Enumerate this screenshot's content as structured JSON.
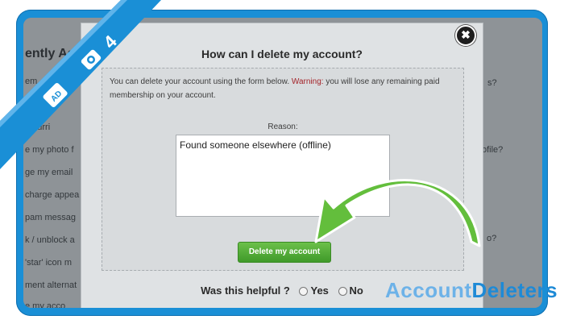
{
  "background_page": {
    "title": "ently As",
    "left_lines": [
      "em",
      "recurri",
      "e my photo f",
      "ge my email",
      "charge appea",
      "pam messag",
      "k / unblock a",
      "'star' icon m",
      "ment alternat",
      "e my acco"
    ],
    "right_lines": [
      "s?",
      "ofile?",
      "o?"
    ]
  },
  "modal": {
    "title": "How can I delete my account?",
    "close_symbol": "✖",
    "info_prefix": "You can delete your account using the form below. ",
    "info_warning": "Warning:",
    "info_suffix": " you will lose any remaining paid membership on your account.",
    "reason_label": "Reason:",
    "reason_value": "Found someone elsewhere (offline)",
    "delete_button": "Delete my account",
    "helpful_question": "Was this helpful ?",
    "helpful_yes": "Yes",
    "helpful_no": "No"
  },
  "banner": {
    "step_number": "4"
  },
  "brand": {
    "part1": "Account",
    "part2": "Deleters"
  },
  "colors": {
    "frame": "#1a8fd6",
    "button": "#4fae35",
    "arrow": "#5fbd3b",
    "warning": "#a4242a"
  }
}
